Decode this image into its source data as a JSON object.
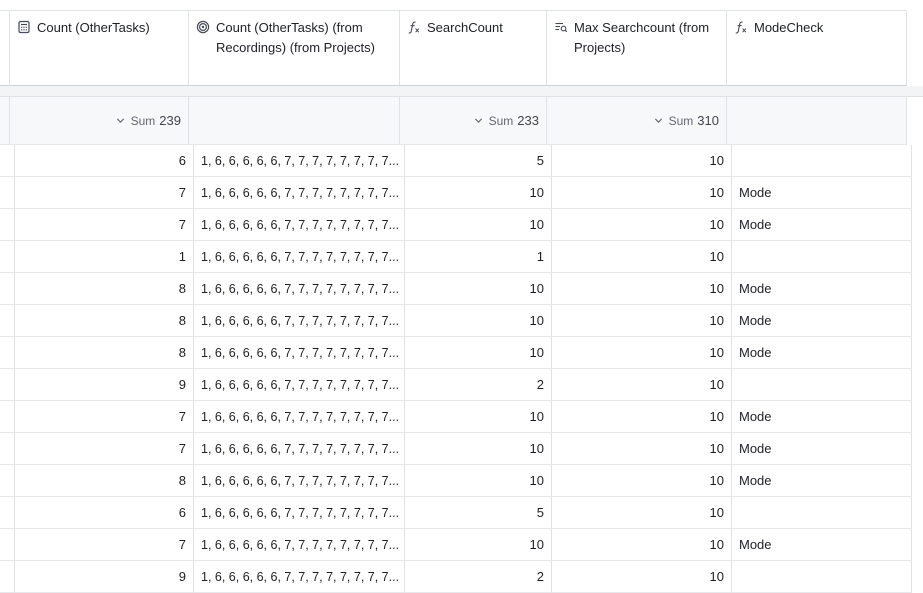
{
  "columns": [
    {
      "label": "Count (OtherTasks)",
      "icon": "count-icon"
    },
    {
      "label": "Count (OtherTasks) (from Recordings) (from Projects)",
      "icon": "lookup-icon"
    },
    {
      "label": "SearchCount",
      "icon": "formula-icon"
    },
    {
      "label": "Max Searchcount (from Projects)",
      "icon": "rollup-icon"
    },
    {
      "label": "ModeCheck",
      "icon": "formula-icon"
    }
  ],
  "summary": {
    "sum_label": "Sum",
    "count_other_tasks": "239",
    "search_count": "233",
    "max_searchcount": "310"
  },
  "rows": [
    {
      "count": "6",
      "list": "1, 6, 6, 6, 6, 6, 7, 7, 7, 7, 7, 7, 7, 7...",
      "search": "5",
      "max": "10",
      "mode": ""
    },
    {
      "count": "7",
      "list": "1, 6, 6, 6, 6, 6, 7, 7, 7, 7, 7, 7, 7, 7...",
      "search": "10",
      "max": "10",
      "mode": "Mode"
    },
    {
      "count": "7",
      "list": "1, 6, 6, 6, 6, 6, 7, 7, 7, 7, 7, 7, 7, 7...",
      "search": "10",
      "max": "10",
      "mode": "Mode"
    },
    {
      "count": "1",
      "list": "1, 6, 6, 6, 6, 6, 7, 7, 7, 7, 7, 7, 7, 7...",
      "search": "1",
      "max": "10",
      "mode": ""
    },
    {
      "count": "8",
      "list": "1, 6, 6, 6, 6, 6, 7, 7, 7, 7, 7, 7, 7, 7...",
      "search": "10",
      "max": "10",
      "mode": "Mode"
    },
    {
      "count": "8",
      "list": "1, 6, 6, 6, 6, 6, 7, 7, 7, 7, 7, 7, 7, 7...",
      "search": "10",
      "max": "10",
      "mode": "Mode"
    },
    {
      "count": "8",
      "list": "1, 6, 6, 6, 6, 6, 7, 7, 7, 7, 7, 7, 7, 7...",
      "search": "10",
      "max": "10",
      "mode": "Mode"
    },
    {
      "count": "9",
      "list": "1, 6, 6, 6, 6, 6, 7, 7, 7, 7, 7, 7, 7, 7...",
      "search": "2",
      "max": "10",
      "mode": ""
    },
    {
      "count": "7",
      "list": "1, 6, 6, 6, 6, 6, 7, 7, 7, 7, 7, 7, 7, 7...",
      "search": "10",
      "max": "10",
      "mode": "Mode"
    },
    {
      "count": "7",
      "list": "1, 6, 6, 6, 6, 6, 7, 7, 7, 7, 7, 7, 7, 7...",
      "search": "10",
      "max": "10",
      "mode": "Mode"
    },
    {
      "count": "8",
      "list": "1, 6, 6, 6, 6, 6, 7, 7, 7, 7, 7, 7, 7, 7...",
      "search": "10",
      "max": "10",
      "mode": "Mode"
    },
    {
      "count": "6",
      "list": "1, 6, 6, 6, 6, 6, 7, 7, 7, 7, 7, 7, 7, 7...",
      "search": "5",
      "max": "10",
      "mode": ""
    },
    {
      "count": "7",
      "list": "1, 6, 6, 6, 6, 6, 7, 7, 7, 7, 7, 7, 7, 7...",
      "search": "10",
      "max": "10",
      "mode": "Mode"
    },
    {
      "count": "9",
      "list": "1, 6, 6, 6, 6, 6, 7, 7, 7, 7, 7, 7, 7, 7...",
      "search": "2",
      "max": "10",
      "mode": ""
    }
  ]
}
